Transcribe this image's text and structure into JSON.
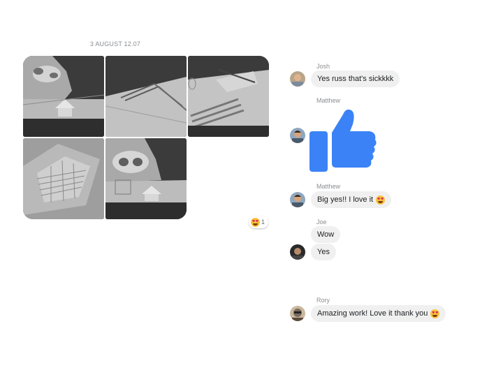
{
  "conversation": {
    "timestamp": "3 AUGUST 12.07",
    "photo_reaction": {
      "emoji": "heart-eyes",
      "count": "1"
    },
    "messages": [
      {
        "sender": "Josh",
        "text": "Yes russ that's sickkkk"
      },
      {
        "sender": "Matthew",
        "type": "thumbs-up"
      },
      {
        "sender": "Matthew",
        "text": "Big yes!! I love it",
        "emoji": "heart-eyes"
      },
      {
        "sender": "Joe",
        "text": "Wow"
      },
      {
        "sender": "",
        "text": "Yes"
      },
      {
        "sender": "Rory",
        "text": "Amazing work! Love it thank you",
        "emoji": "heart-eyes"
      }
    ]
  },
  "colors": {
    "like_blue": "#3b82f6",
    "bubble_gray": "#f0f0f0",
    "meta_gray": "#8a8d91"
  }
}
